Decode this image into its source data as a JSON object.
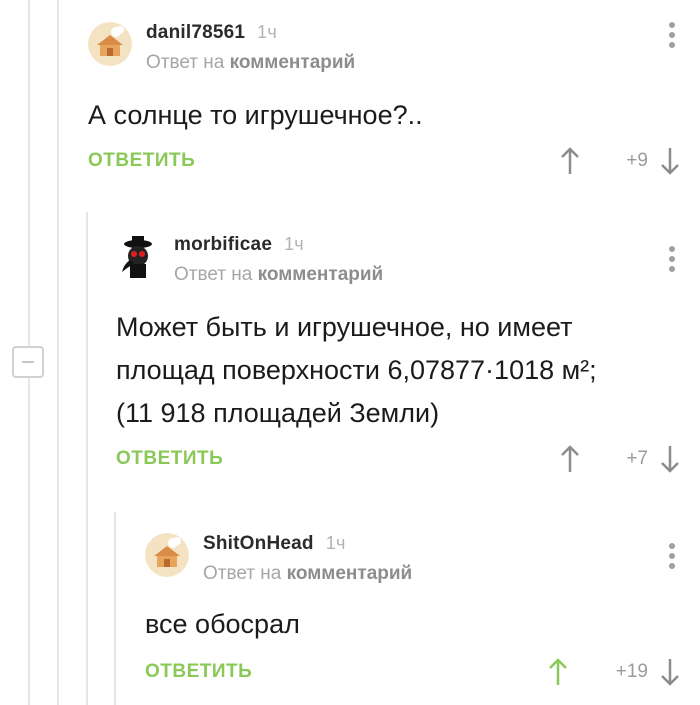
{
  "comments": [
    {
      "author": "danil78561",
      "time": "1ч",
      "reply_prefix": "Ответ на",
      "reply_target": "комментарий",
      "text": "А солнце то игрушечное?..",
      "reply_label": "ОТВЕТИТЬ",
      "score": "+9",
      "avatar_icon": "house-avatar-icon",
      "upvoted": false
    },
    {
      "author": "morbificae",
      "time": "1ч",
      "reply_prefix": "Ответ на",
      "reply_target": "комментарий",
      "text_lines": [
        "Может быть и игрушечное, но имеет",
        "площад поверхности 6,07877·1018 м²;",
        "(11 918 площадей Земли)"
      ],
      "reply_label": "ОТВЕТИТЬ",
      "score": "+7",
      "avatar_icon": "plague-doctor-avatar-icon",
      "upvoted": false
    },
    {
      "author": "ShitOnHead",
      "time": "1ч",
      "reply_prefix": "Ответ на",
      "reply_target": "комментарий",
      "text": "все обосрал",
      "reply_label": "ОТВЕТИТЬ",
      "score": "+19",
      "avatar_icon": "house-avatar-icon",
      "upvoted": true
    }
  ],
  "colors": {
    "accent_green": "#8ac858",
    "muted_gray": "#a6a6a6",
    "thread_line": "#e6e6e6"
  }
}
